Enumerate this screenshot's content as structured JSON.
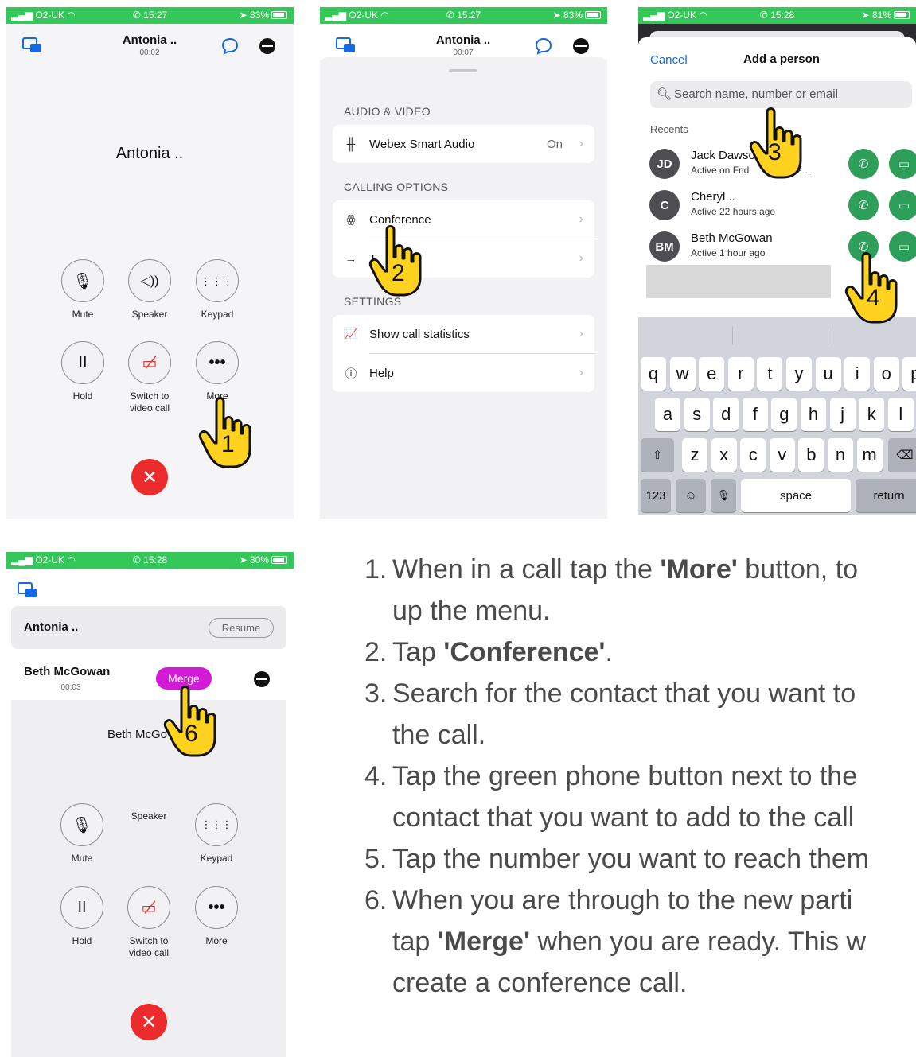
{
  "status_bars": [
    {
      "carrier": "O2-UK",
      "time": "15:27",
      "battery": "83%"
    },
    {
      "carrier": "O2-UK",
      "time": "15:27",
      "battery": "83%"
    },
    {
      "carrier": "O2-UK",
      "time": "15:28",
      "battery": "81%"
    },
    {
      "carrier": "O2-UK",
      "time": "15:28",
      "battery": "80%"
    }
  ],
  "screen1": {
    "caller_short": "Antonia ..",
    "timer": "00:02",
    "caller_big": "Antonia ..",
    "buttons": {
      "mute": "Mute",
      "speaker": "Speaker",
      "keypad": "Keypad",
      "hold": "Hold",
      "switch_video": "Switch to video call",
      "more": "More"
    },
    "step_marker": "1"
  },
  "screen2": {
    "caller_short": "Antonia ..",
    "timer": "00:07",
    "section_audio": "AUDIO & VIDEO",
    "smart_audio_label": "Webex Smart Audio",
    "smart_audio_value": "On",
    "section_calling": "CALLING OPTIONS",
    "conference_label": "Conference",
    "transfer_label": "T",
    "section_settings": "SETTINGS",
    "stats_label": "Show call statistics",
    "help_label": "Help",
    "step_marker": "2"
  },
  "screen3": {
    "cancel": "Cancel",
    "title": "Add a person",
    "search_placeholder": "Search name, number or email",
    "recents_label": "Recents",
    "contacts": [
      {
        "initials": "JD",
        "name": "Jack Dawso",
        "status": "Active on Frid",
        "status_tail": "/12/2..."
      },
      {
        "initials": "C",
        "name": "Cheryl ..",
        "status": "Active 22 hours ago",
        "status_tail": ""
      },
      {
        "initials": "BM",
        "name": "Beth McGowan",
        "status": "Active 1 hour ago",
        "status_tail": ""
      }
    ],
    "keyboard_rows": [
      [
        "q",
        "w",
        "e",
        "r",
        "t",
        "y",
        "u",
        "i",
        "o",
        "p"
      ],
      [
        "a",
        "s",
        "d",
        "f",
        "g",
        "h",
        "j",
        "k",
        "l"
      ],
      [
        "z",
        "x",
        "c",
        "v",
        "b",
        "n",
        "m"
      ]
    ],
    "key_123": "123",
    "key_space": "space",
    "key_return": "return",
    "step_marker_3": "3",
    "step_marker_4": "4"
  },
  "screen4": {
    "held_name": "Antonia ..",
    "resume_label": "Resume",
    "active_name": "Beth McGowan",
    "active_timer": "00:03",
    "merge_label": "Merge",
    "caller_big": "Beth McGo",
    "buttons": {
      "mute": "Mute",
      "speaker": "Speaker",
      "keypad": "Keypad",
      "hold": "Hold",
      "switch_video": "Switch to video call",
      "more": "More"
    },
    "step_marker": "6"
  },
  "instructions": [
    {
      "num": "1.",
      "pre": "When in a call tap the ",
      "bold": "'More'",
      "post": " button, to",
      "line2": "up the menu."
    },
    {
      "num": "2.",
      "pre": "Tap ",
      "bold": "'Conference'",
      "post": ".",
      "line2": ""
    },
    {
      "num": "3.",
      "pre": "Search for the contact that you want to",
      "bold": "",
      "post": "",
      "line2": "the call."
    },
    {
      "num": "4.",
      "pre": "Tap the green phone button next to the",
      "bold": "",
      "post": "",
      "line2": "contact that you want to add to the call"
    },
    {
      "num": "5.",
      "pre": "Tap the number you want to reach them",
      "bold": "",
      "post": "",
      "line2": ""
    },
    {
      "num": "6.",
      "pre": "When you are through to the new parti",
      "bold": "",
      "post": "",
      "line2": ""
    }
  ],
  "instruction6_line2_pre": "tap ",
  "instruction6_line2_bold": "'Merge'",
  "instruction6_line2_post": " when you are ready. This w",
  "instruction6_line3": "create a conference call.",
  "colors": {
    "status_green": "#34c759",
    "end_red": "#ec2c2c",
    "merge_magenta": "#d21ad7",
    "call_green": "#2e9e5b",
    "link_blue": "#1769e0"
  }
}
